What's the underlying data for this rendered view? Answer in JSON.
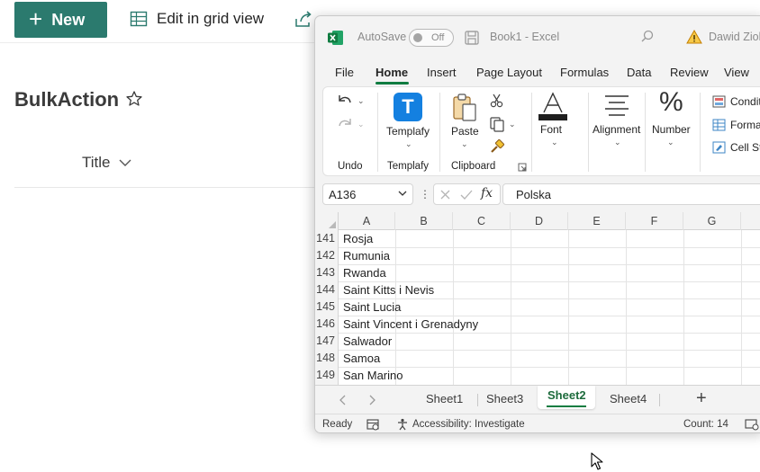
{
  "sharepoint": {
    "new_label": "New",
    "grid_label": "Edit in grid view",
    "list_title": "BulkAction",
    "column_title": "Title"
  },
  "excel": {
    "autosave_label": "AutoSave",
    "autosave_state": "Off",
    "book_name": "Book1  -  Excel",
    "user_name": "Dawid Ziol",
    "menu": [
      "File",
      "Home",
      "Insert",
      "Page Layout",
      "Formulas",
      "Data",
      "Review",
      "View"
    ],
    "active_menu": "Home",
    "ribbon": {
      "undo_group": "Undo",
      "templafy_button": "Templafy",
      "templafy_group": "Templafy",
      "paste_button": "Paste",
      "clipboard_group": "Clipboard",
      "font_button": "Font",
      "alignment_button": "Alignment",
      "number_button": "Number",
      "styles": [
        "Conditi",
        "Forma",
        "Cell Sty"
      ]
    },
    "name_box": "A136",
    "formula_value": "Polska",
    "columns": [
      "A",
      "B",
      "C",
      "D",
      "E",
      "F",
      "G"
    ],
    "rows": [
      {
        "num": "141",
        "value": "Rosja"
      },
      {
        "num": "142",
        "value": "Rumunia"
      },
      {
        "num": "143",
        "value": "Rwanda"
      },
      {
        "num": "144",
        "value": "Saint Kitts i Nevis"
      },
      {
        "num": "145",
        "value": "Saint Lucia"
      },
      {
        "num": "146",
        "value": "Saint Vincent i Grenadyny"
      },
      {
        "num": "147",
        "value": "Salwador"
      },
      {
        "num": "148",
        "value": "Samoa"
      },
      {
        "num": "149",
        "value": "San Marino"
      }
    ],
    "sheets": [
      "Sheet1",
      "Sheet3",
      "Sheet2",
      "Sheet4"
    ],
    "active_sheet": "Sheet2",
    "status": {
      "ready": "Ready",
      "accessibility": "Accessibility: Investigate",
      "count": "Count: 14"
    },
    "colors": {
      "accent": "#107c41",
      "sp_brand": "#2b7a6e"
    }
  }
}
